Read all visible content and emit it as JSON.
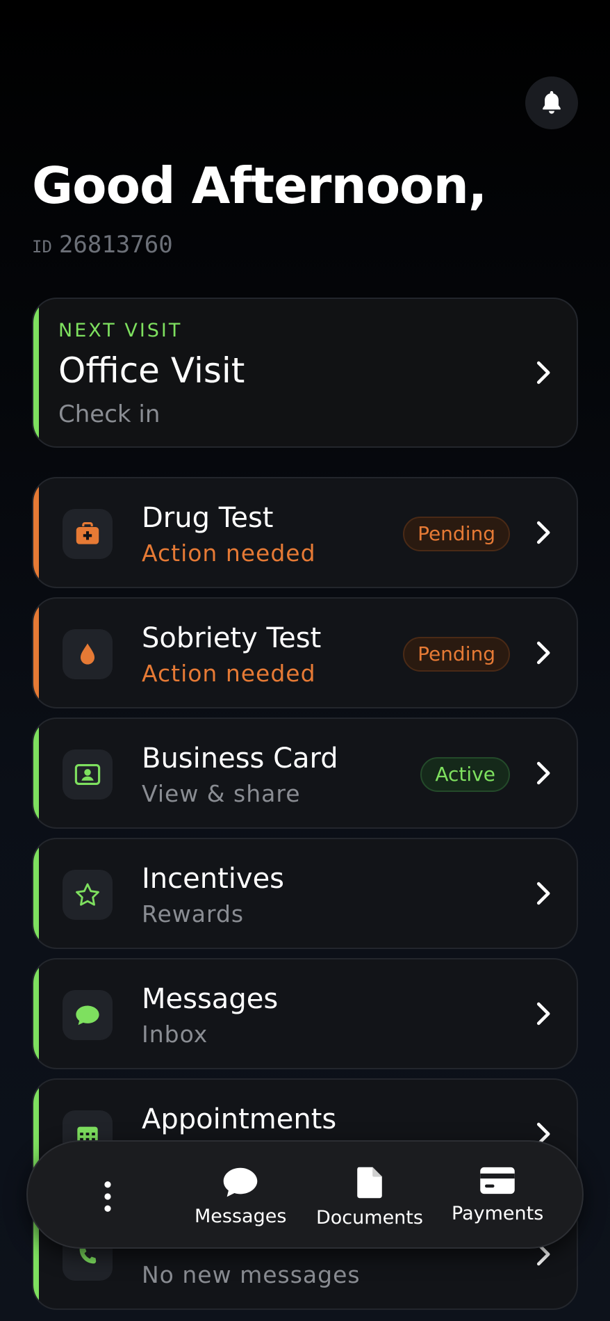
{
  "header": {
    "greeting": "Good Afternoon,",
    "id_prefix": "ID",
    "id_value": "26813760",
    "bell_icon": "bell-icon"
  },
  "colors": {
    "accent_green": "#7ee05f",
    "accent_orange": "#e67a35",
    "card_bg": "#121418"
  },
  "next_visit": {
    "label": "NEXT VISIT",
    "title": "Office Visit",
    "subtitle": "Check in"
  },
  "items": [
    {
      "title": "Drug Test",
      "subtitle": "Action needed",
      "badge": "Pending",
      "icon": "medical-kit-icon",
      "status": "warning"
    },
    {
      "title": "Sobriety Test",
      "subtitle": "Action needed",
      "badge": "Pending",
      "icon": "drop-icon",
      "status": "warning"
    },
    {
      "title": "Business Card",
      "subtitle": "View & share",
      "badge": "Active",
      "icon": "id-card-icon",
      "status": "ok"
    },
    {
      "title": "Incentives",
      "subtitle": "Rewards",
      "icon": "star-icon",
      "status": "ok"
    },
    {
      "title": "Messages",
      "subtitle": "Inbox",
      "icon": "chat-icon",
      "status": "ok"
    },
    {
      "title": "Appointments",
      "subtitle": "",
      "icon": "calendar-icon",
      "status": "ok"
    },
    {
      "title": "",
      "subtitle": "No new messages",
      "icon": "phone-icon",
      "status": "ok"
    }
  ],
  "bottom_nav": {
    "more_icon": "more-vertical-icon",
    "items": [
      {
        "label": "Messages",
        "icon": "chat-bubble-icon"
      },
      {
        "label": "Documents",
        "icon": "document-icon"
      },
      {
        "label": "Payments",
        "icon": "credit-card-icon"
      }
    ]
  }
}
